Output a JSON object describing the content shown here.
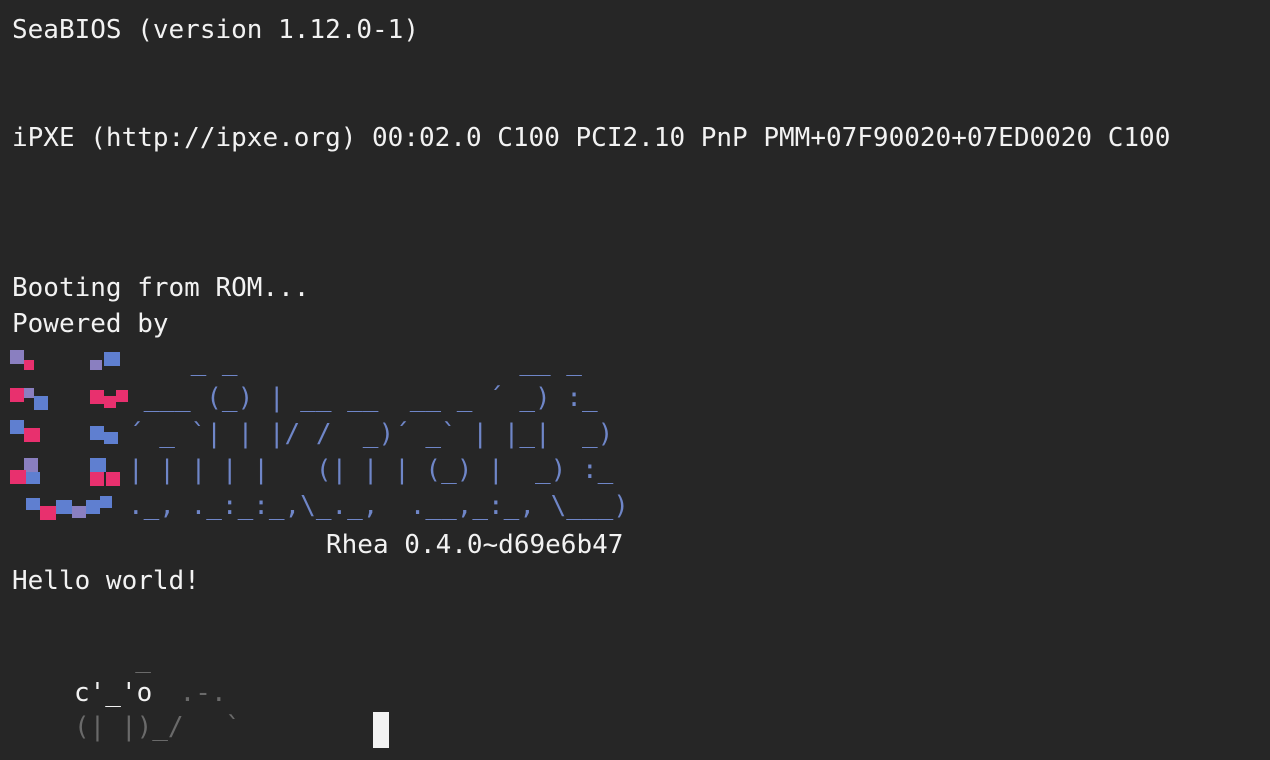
{
  "console": {
    "lines": {
      "seabios": "SeaBIOS (version 1.12.0-1)",
      "ipxe": "iPXE (http://ipxe.org) 00:02.0 C100 PCI2.10 PnP PMM+07F90020+07ED0020 C100",
      "booting": "Booting from ROM...",
      "powered": "Powered by",
      "version": "Rhea 0.4.0~d69e6b47",
      "hello": "Hello world!"
    },
    "banner_ascii": {
      "row1": "    _ _                  __ _",
      "row2": " ___ (_) | __ __  __ _ ´ _) :_",
      "row3": "´ _ `| | |/ /  _)´ _` | |_|  _)",
      "row4": "| | | | |   (| | | (_) |  _) :_",
      "row5": "._, ._:_:_,\\_._,  .__,_:_, \\___)"
    },
    "monkey_art": {
      "row0": "  _",
      "row1": "c'_'o",
      "row1_dim": " .-.",
      "row2": "(| |)_/",
      "row2_dim": "  `"
    },
    "colors": {
      "background": "#262626",
      "text": "#f2f2f2",
      "banner_blue": "#6f86c8",
      "logo_pink": "#e8306e",
      "logo_purple": "#8a7fc0",
      "logo_blue": "#5f7fd0",
      "dim": "#6a6a6a"
    }
  }
}
